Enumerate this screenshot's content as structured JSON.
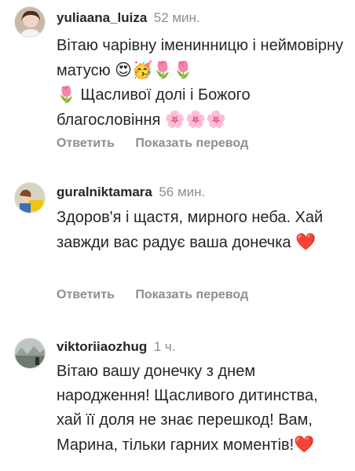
{
  "comments": [
    {
      "username": "yuliaana_luiza",
      "time": "52 мин.",
      "text": "Вітаю чарівну іменинницю і неймовірну матусю",
      "emojis": "😍🥳🌷🌷",
      "text2": "🌷 Щасливої долі і Божого благословіння",
      "emojis2": "🌸🌸🌸",
      "reply_label": "Ответить",
      "translate_label": "Показать перевод"
    },
    {
      "username": "guralniktamara",
      "time": "56 мин.",
      "text": "Здоров'я і щастя, мирного неба. Хай завжди вас радує ваша донечка",
      "emojis": "❤️",
      "reply_label": "Ответить",
      "translate_label": "Показать перевод"
    },
    {
      "username": "viktoriiaozhug",
      "time": "1 ч.",
      "text": "Вітаю вашу донечку з днем народження! Щасливого дитинства, хай її доля не знає перешкод! Вам, Марина, тільки гарних моментів!",
      "emojis": "❤️"
    }
  ]
}
